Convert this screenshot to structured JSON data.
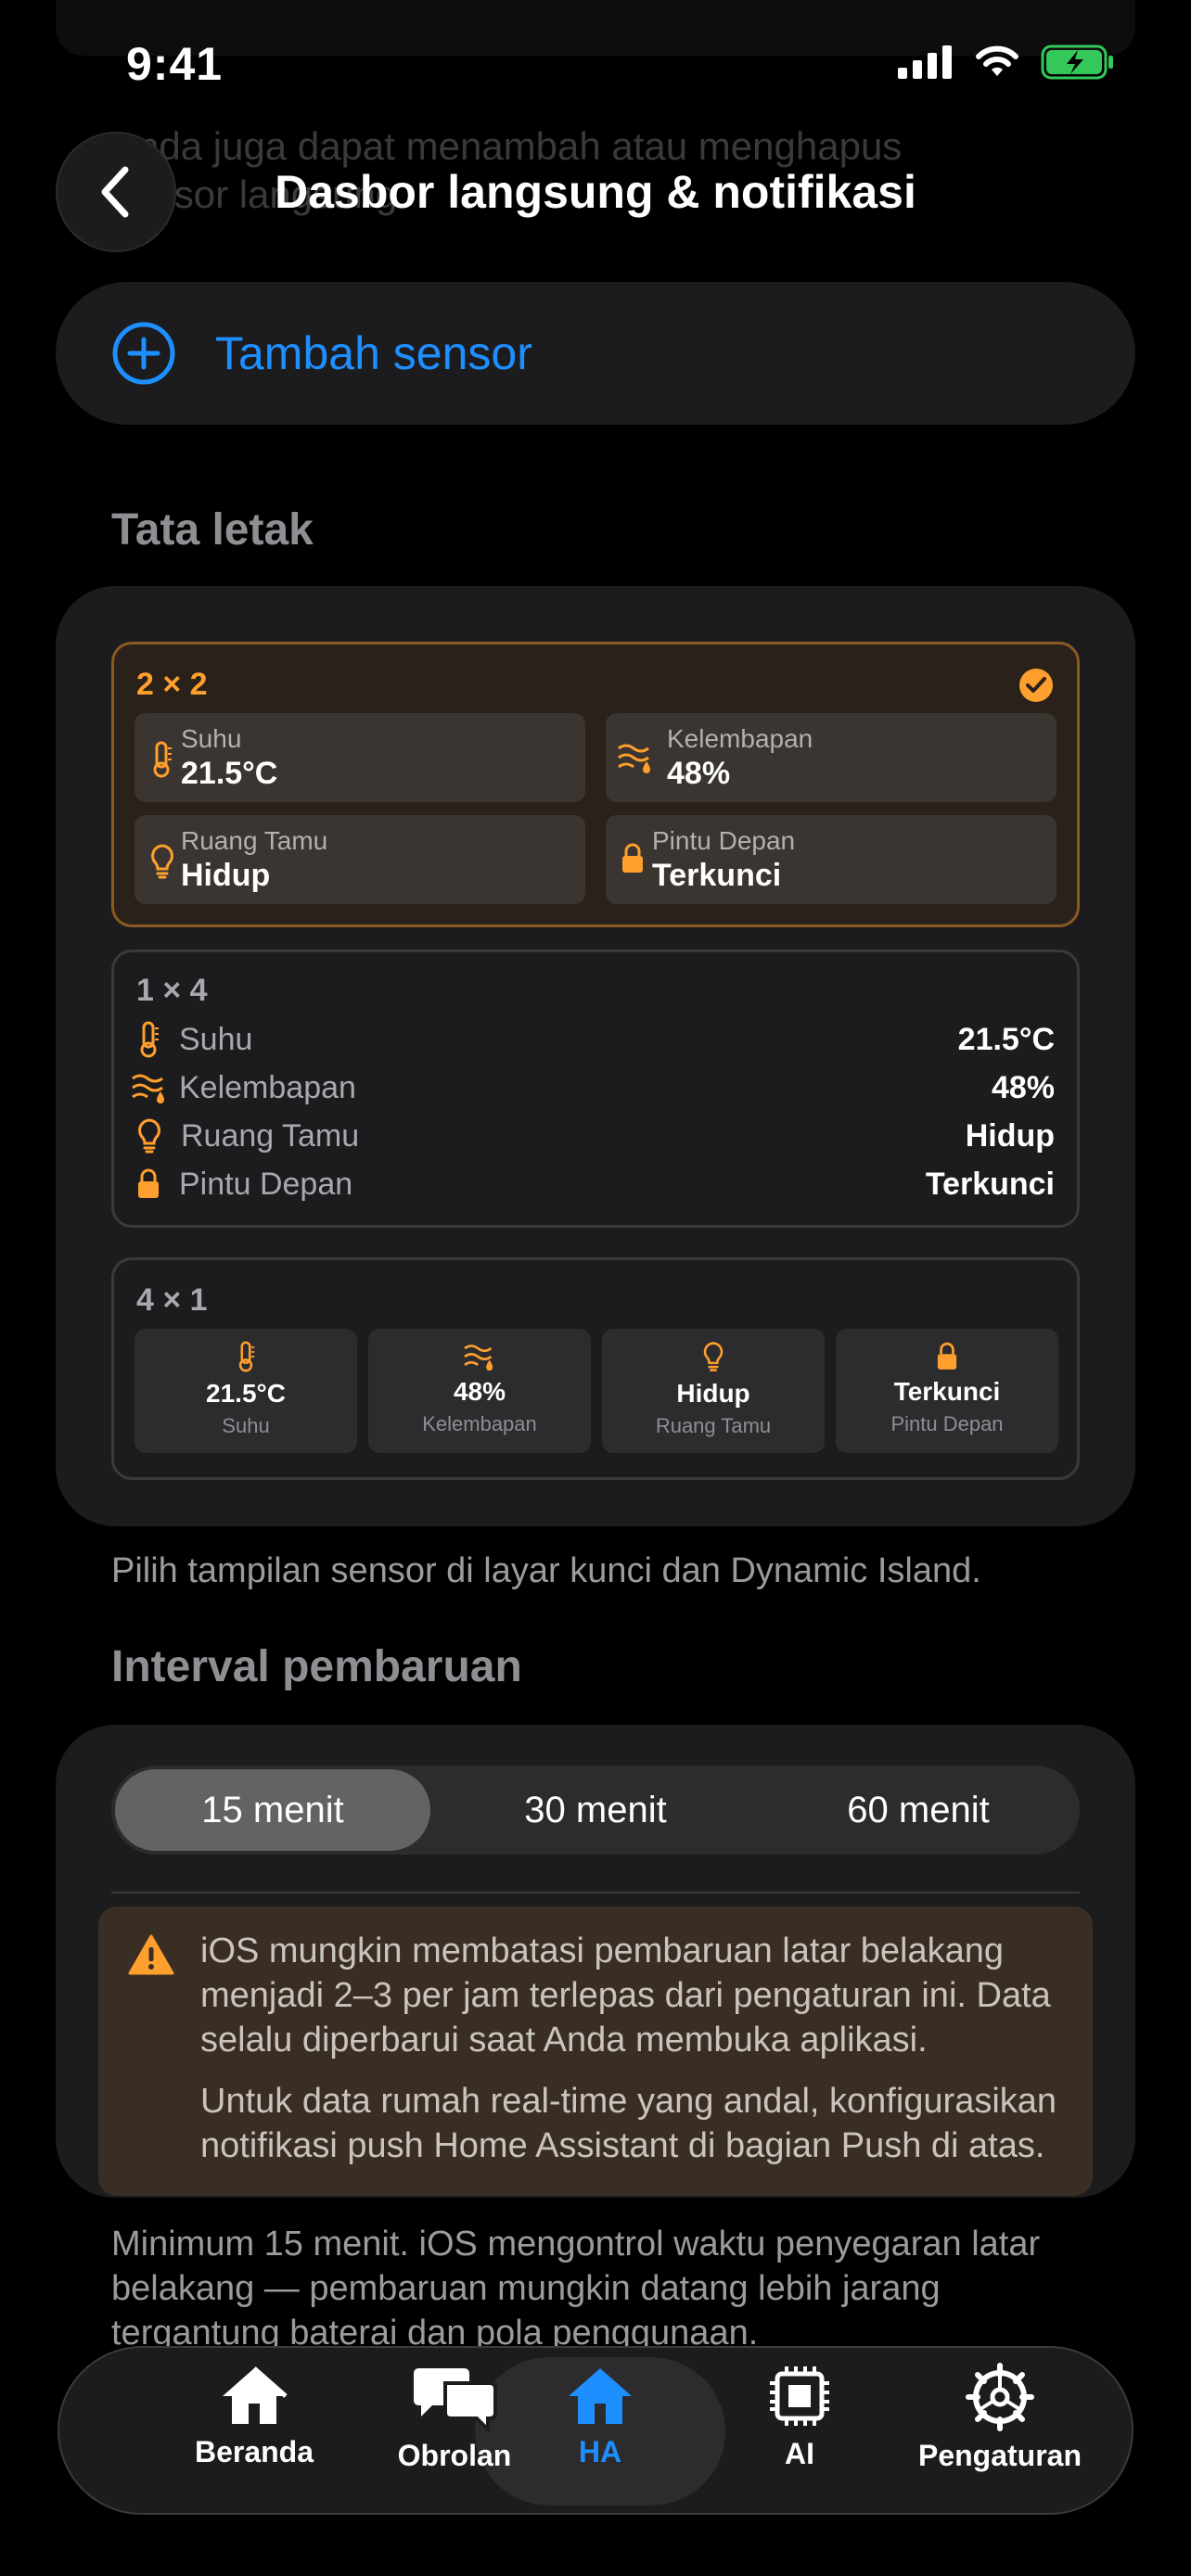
{
  "status": {
    "time": "9:41"
  },
  "background_text": "Anda juga dapat menambah atau menghapus sensor langsung",
  "header": {
    "title": "Dasbor langsung & notifikasi",
    "back_icon": "chevron-left-icon"
  },
  "add_sensor": {
    "label": "Tambah sensor",
    "icon": "plus-circle-icon"
  },
  "layout": {
    "title": "Tata letak",
    "options": {
      "grid_2x2": {
        "label": "2 × 2",
        "selected": true,
        "tiles": [
          {
            "name": "Suhu",
            "value": "21.5°C",
            "icon": "thermometer-icon"
          },
          {
            "name": "Kelembapan",
            "value": "48%",
            "icon": "humidity-icon"
          },
          {
            "name": "Ruang Tamu",
            "value": "Hidup",
            "icon": "lightbulb-icon"
          },
          {
            "name": "Pintu Depan",
            "value": "Terkunci",
            "icon": "lock-icon"
          }
        ]
      },
      "list_1x4": {
        "label": "1 × 4",
        "rows": [
          {
            "name": "Suhu",
            "value": "21.5°C",
            "icon": "thermometer-icon"
          },
          {
            "name": "Kelembapan",
            "value": "48%",
            "icon": "humidity-icon"
          },
          {
            "name": "Ruang Tamu",
            "value": "Hidup",
            "icon": "lightbulb-icon"
          },
          {
            "name": "Pintu Depan",
            "value": "Terkunci",
            "icon": "lock-icon"
          }
        ]
      },
      "row_4x1": {
        "label": "4 × 1",
        "cols": [
          {
            "name": "Suhu",
            "value": "21.5°C",
            "icon": "thermometer-icon"
          },
          {
            "name": "Kelembapan",
            "value": "48%",
            "icon": "humidity-icon"
          },
          {
            "name": "Ruang Tamu",
            "value": "Hidup",
            "icon": "lightbulb-icon"
          },
          {
            "name": "Pintu Depan",
            "value": "Terkunci",
            "icon": "lock-icon"
          }
        ]
      }
    },
    "footer": "Pilih tampilan sensor di layar kunci dan Dynamic Island."
  },
  "interval": {
    "title": "Interval pembaruan",
    "options": [
      "15 menit",
      "30 menit",
      "60 menit"
    ],
    "selected": "15 menit",
    "warning": {
      "icon": "warning-triangle-icon",
      "text1": "iOS mungkin membatasi pembaruan latar belakang menjadi 2–3 per jam terlepas dari pengaturan ini. Data selalu diperbarui saat Anda membuka aplikasi.",
      "text2": "Untuk data rumah real-time yang andal, konfigurasikan notifikasi push Home Assistant di bagian Push di atas."
    },
    "footer": "Minimum 15 menit. iOS mengontrol waktu penyegaran latar belakang — pembaruan mungkin datang lebih jarang tergantung baterai dan pola penggunaan."
  },
  "tabbar": {
    "tabs": [
      {
        "label": "Beranda",
        "icon": "home-icon"
      },
      {
        "label": "Obrolan",
        "icon": "chat-bubbles-icon"
      },
      {
        "label": "HA",
        "icon": "home-assistant-icon"
      },
      {
        "label": "AI",
        "icon": "chip-icon"
      },
      {
        "label": "Pengaturan",
        "icon": "gear-icon"
      }
    ],
    "active": "HA"
  },
  "colors": {
    "accent_blue": "#1E8FFF",
    "accent_orange": "#FF9F2E",
    "battery_green": "#34C759"
  }
}
